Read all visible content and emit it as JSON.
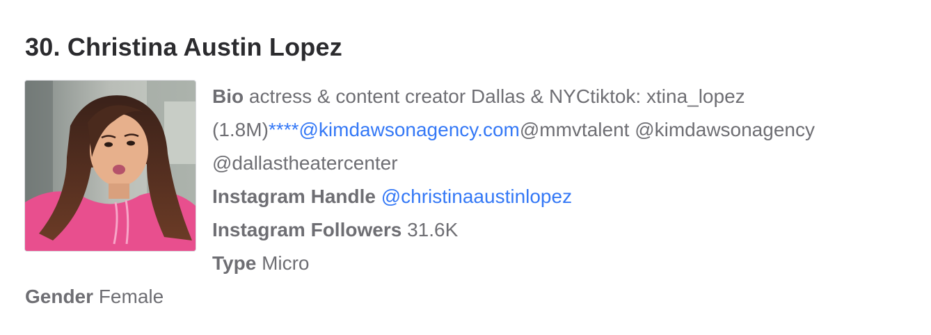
{
  "profile": {
    "title": "30. Christina Austin Lopez",
    "photo_icon": "portrait-photo",
    "bio": {
      "label": "Bio",
      "line1": "actress & content creator Dallas & NYCtiktok: xtina_lopez",
      "line2_prefix": "(1.8M)",
      "line2_link": "****@kimdawsonagency.com",
      "line2_suffix": "@mmvtalent @kimdawsonagency",
      "line3": "@dallastheatercenter"
    },
    "instagram_handle": {
      "label": "Instagram Handle",
      "value": "@christinaaustinlopez"
    },
    "instagram_followers": {
      "label": "Instagram Followers",
      "value": "31.6K"
    },
    "type": {
      "label": "Type",
      "value": "Micro"
    },
    "gender": {
      "label": "Gender",
      "value": "Female"
    }
  },
  "colors": {
    "link": "#3478f6",
    "heading": "#2b2b2e",
    "text": "#6e6e73"
  }
}
